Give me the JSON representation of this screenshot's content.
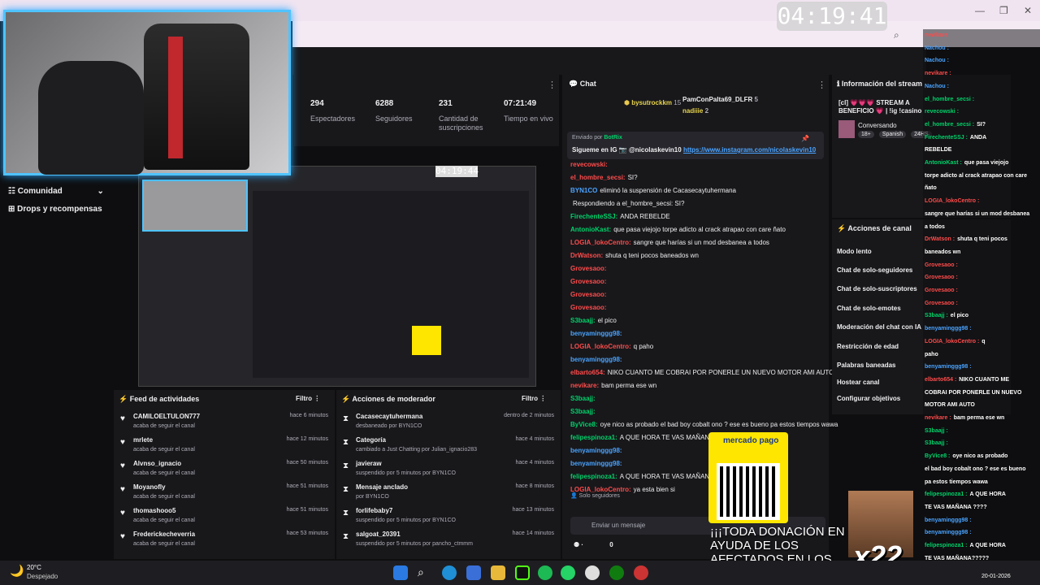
{
  "clock": "04:19:41",
  "preview_clock": "04:19:44",
  "stats": [
    {
      "value": "294",
      "label": "Espectadores"
    },
    {
      "value": "6288",
      "label": "Seguidores"
    },
    {
      "value": "231",
      "label": "Cantidad de suscripciones"
    },
    {
      "value": "07:21:49",
      "label": "Tiempo en vivo"
    }
  ],
  "leftnav": {
    "comunidad": "Comunidad",
    "drops": "Drops y recompensas"
  },
  "chat": {
    "title": "Chat",
    "top_users": [
      {
        "name": "bysutrockkm",
        "n": "15"
      },
      {
        "name": "PamConPalta69_DLFR",
        "n": "5"
      },
      {
        "name": "nadiiie",
        "n": "2"
      }
    ],
    "pinned_by": "Enviado por",
    "pinned_user": "BotRix",
    "pinned_text": "Siguеme en IG 📷 @nicolaskevin10",
    "pinned_link": "https://www.instagram.com/nicolaskevin10",
    "messages": [
      {
        "u": "revecowski:",
        "c": "u-red",
        "t": ""
      },
      {
        "u": "el_hombre_secsi:",
        "c": "u-red",
        "t": "SI?"
      },
      {
        "u": "BYN1CO",
        "c": "u-blue",
        "t": "eliminó la suspensión de Cacasecaytuhermana"
      },
      {
        "u": "",
        "c": "",
        "t": "Respondiendo a el_hombre_secsi: SI?"
      },
      {
        "u": "FirechenteSSJ:",
        "c": "u-green",
        "t": "ANDA REBELDE"
      },
      {
        "u": "AntonioKast:",
        "c": "u-green",
        "t": "que pasa viejojo torpe adicto al crack atrapao con care ñato"
      },
      {
        "u": "LOGIA_lokoCentro:",
        "c": "u-red",
        "t": "sangre que harías si un mod desbanea a todos"
      },
      {
        "u": "DrWatson:",
        "c": "u-red",
        "t": "shuta q teni pocos baneados wn"
      },
      {
        "u": "Grovesaoo:",
        "c": "u-red",
        "t": ""
      },
      {
        "u": "Grovesaoo:",
        "c": "u-red",
        "t": ""
      },
      {
        "u": "Grovesaoo:",
        "c": "u-red",
        "t": ""
      },
      {
        "u": "Grovesaoo:",
        "c": "u-red",
        "t": ""
      },
      {
        "u": "S3baajj:",
        "c": "u-green",
        "t": "el pico"
      },
      {
        "u": "benyaminggg98:",
        "c": "u-blue",
        "t": ""
      },
      {
        "u": "LOGIA_lokoCentro:",
        "c": "u-red",
        "t": "q paho"
      },
      {
        "u": "benyaminggg98:",
        "c": "u-blue",
        "t": ""
      },
      {
        "u": "elbarto654:",
        "c": "u-red",
        "t": "NIKO CUANTO ME COBRAI POR PONERLE UN NUEVO MOTOR AMI AUTO"
      },
      {
        "u": "nevikare:",
        "c": "u-red",
        "t": "bam perma ese wn"
      },
      {
        "u": "S3baajj:",
        "c": "u-green",
        "t": ""
      },
      {
        "u": "S3baajj:",
        "c": "u-green",
        "t": ""
      },
      {
        "u": "ByVice8:",
        "c": "u-green",
        "t": "oye nico as probado el bad boy cobalt ono ? ese es bueno pa estos tiempos wawa"
      },
      {
        "u": "felipespinoza1:",
        "c": "u-green",
        "t": "A QUE HORA TE VAS MAÑANA ????"
      },
      {
        "u": "benyaminggg98:",
        "c": "u-blue",
        "t": ""
      },
      {
        "u": "benyaminggg98:",
        "c": "u-blue",
        "t": ""
      },
      {
        "u": "felipespinoza1:",
        "c": "u-green",
        "t": "A QUE HORA TE VAS MAÑANA?????"
      },
      {
        "u": "LOGIA_lokoCentro:",
        "c": "u-red",
        "t": "ya esta bien si"
      }
    ],
    "solo_seguidores": "Solo seguidores",
    "send_placeholder": "Enviar un mensaje",
    "points": "0"
  },
  "feed": {
    "title": "Feed de actividades",
    "filter": "Filtro",
    "rows": [
      {
        "name": "CAMILOELTULON777",
        "sub": "acaba de seguir el canal",
        "time": "hace 6 minutos"
      },
      {
        "name": "mrlete",
        "sub": "acaba de seguir el canal",
        "time": "hace 12 minutos"
      },
      {
        "name": "Alvnso_ignacio",
        "sub": "acaba de seguir el canal",
        "time": "hace 50 minutos"
      },
      {
        "name": "Moyanofly",
        "sub": "acaba de seguir el canal",
        "time": "hace 51 minutos"
      },
      {
        "name": "thomashooo5",
        "sub": "acaba de seguir el canal",
        "time": "hace 51 minutos"
      },
      {
        "name": "Frederickecheverria",
        "sub": "acaba de seguir el canal",
        "time": "hace 53 minutos"
      }
    ]
  },
  "mod": {
    "title": "Acciones de moderador",
    "filter": "Filtro",
    "rows": [
      {
        "name": "Cacasecaytuhermana",
        "sub": "desbaneado por BYN1CO",
        "time": "dentro de 2 minutos"
      },
      {
        "name": "Categoría",
        "sub": "cambiado a Just Chatting por Julian_ignacio283",
        "time": "hace 4 minutos"
      },
      {
        "name": "javieraw",
        "sub": "suspendido por 5 minutos por BYN1CO",
        "time": "hace 4 minutos"
      },
      {
        "name": "Mensaje anclado",
        "sub": "por BYN1CO",
        "time": "hace 8 minutos"
      },
      {
        "name": "forlifebaby7",
        "sub": "suspendido por 5 minutos por BYN1CO",
        "time": "hace 13 minutos"
      },
      {
        "name": "salgoat_20391",
        "sub": "suspendido por 5 minutos por pancho_ctmmm",
        "time": "hace 14 minutos"
      }
    ]
  },
  "info": {
    "title": "Información del stream",
    "stream_title": "[cl] 💗💗💗 STREAM A BENEFICIO 💗 | !ig !casino !ds",
    "category": "Conversando",
    "tags": [
      "18+",
      "Spanish",
      "24HS"
    ]
  },
  "actions": {
    "title": "Acciones de canal",
    "items": [
      "Modo lento",
      "Chat de solo-seguidores",
      "Chat de solo-suscriptores",
      "Chat de solo-emotes",
      "Moderación del chat con IA",
      "Restricción de edad",
      "Palabras baneadas",
      "Hostear canal",
      "Configurar objetivos"
    ]
  },
  "rightchat": [
    {
      "u": "nevikare",
      "c": "u-red",
      "t": ""
    },
    {
      "u": "Nachou :",
      "c": "u-blue",
      "t": ""
    },
    {
      "u": "Nachou :",
      "c": "u-blue",
      "t": ""
    },
    {
      "u": "nevikare :",
      "c": "u-red",
      "t": ""
    },
    {
      "u": "Nachou :",
      "c": "u-blue",
      "t": ""
    },
    {
      "u": "el_hombre_secsi :",
      "c": "u-green",
      "t": ""
    },
    {
      "u": "revecowski :",
      "c": "u-green",
      "t": ""
    },
    {
      "u": "el_hombre_secsi :",
      "c": "u-green",
      "t": "SI?"
    },
    {
      "u": "FirechenteSSJ :",
      "c": "u-green",
      "t": "ANDA"
    },
    {
      "u": "REBELDE",
      "c": "",
      "t": ""
    },
    {
      "u": "AntonioKast :",
      "c": "u-green",
      "t": "que pasa viejojo"
    },
    {
      "u": "torpe adicto al crack atrapao con care",
      "c": "",
      "t": ""
    },
    {
      "u": "ñato",
      "c": "",
      "t": ""
    },
    {
      "u": "LOGIA_lokoCentro :",
      "c": "u-red",
      "t": ""
    },
    {
      "u": "sangre que harías si un mod desbanea",
      "c": "",
      "t": ""
    },
    {
      "u": "a todos",
      "c": "",
      "t": ""
    },
    {
      "u": "DrWatson :",
      "c": "u-red",
      "t": "shuta q teni pocos"
    },
    {
      "u": "baneados wn",
      "c": "",
      "t": ""
    },
    {
      "u": "Grovesaoo :",
      "c": "u-red",
      "t": ""
    },
    {
      "u": "Grovesaoo :",
      "c": "u-red",
      "t": ""
    },
    {
      "u": "Grovesaoo :",
      "c": "u-red",
      "t": ""
    },
    {
      "u": "Grovesaoo :",
      "c": "u-red",
      "t": ""
    },
    {
      "u": "S3baajj :",
      "c": "u-green",
      "t": "el pico"
    },
    {
      "u": "benyaminggg98 :",
      "c": "u-blue",
      "t": ""
    },
    {
      "u": "LOGIA_lokoCentro :",
      "c": "u-red",
      "t": "q"
    },
    {
      "u": "paho",
      "c": "",
      "t": ""
    },
    {
      "u": "benyaminggg98 :",
      "c": "u-blue",
      "t": ""
    },
    {
      "u": "elbarto654 :",
      "c": "u-red",
      "t": "NIKO CUANTO ME"
    },
    {
      "u": "COBRAI POR PONERLE UN NUEVO",
      "c": "",
      "t": ""
    },
    {
      "u": "MOTOR AMI AUTO",
      "c": "",
      "t": ""
    },
    {
      "u": "nevikare :",
      "c": "u-red",
      "t": "bam perma ese wn"
    },
    {
      "u": "S3baajj :",
      "c": "u-green",
      "t": ""
    },
    {
      "u": "S3baajj :",
      "c": "u-green",
      "t": ""
    },
    {
      "u": "ByVice8 :",
      "c": "u-green",
      "t": "oye nico as probado"
    },
    {
      "u": "el bad boy cobalt ono ? ese es bueno",
      "c": "",
      "t": ""
    },
    {
      "u": "pa estos tiempos wawa",
      "c": "",
      "t": ""
    },
    {
      "u": "felipespinoza1 :",
      "c": "u-green",
      "t": "A QUE HORA"
    },
    {
      "u": "TE VAS MAÑANA ????",
      "c": "",
      "t": ""
    },
    {
      "u": "benyaminggg98 :",
      "c": "u-blue",
      "t": ""
    },
    {
      "u": "benyaminggg98 :",
      "c": "u-blue",
      "t": ""
    },
    {
      "u": "felipespinoza1 :",
      "c": "u-green",
      "t": "A QUE HORA"
    },
    {
      "u": "TE VAS MAÑANA?????",
      "c": "",
      "t": ""
    }
  ],
  "mercado": {
    "brand": "mercado pago"
  },
  "donation": "¡¡¡TODA DONACIÓN EN AYUDA DE LOS AFECTADOS EN LOS INCENDIOS!!!",
  "x22": "x22",
  "weather": {
    "temp": "20°C",
    "desc": "Despejado"
  },
  "tray_date": "20-01-2026"
}
